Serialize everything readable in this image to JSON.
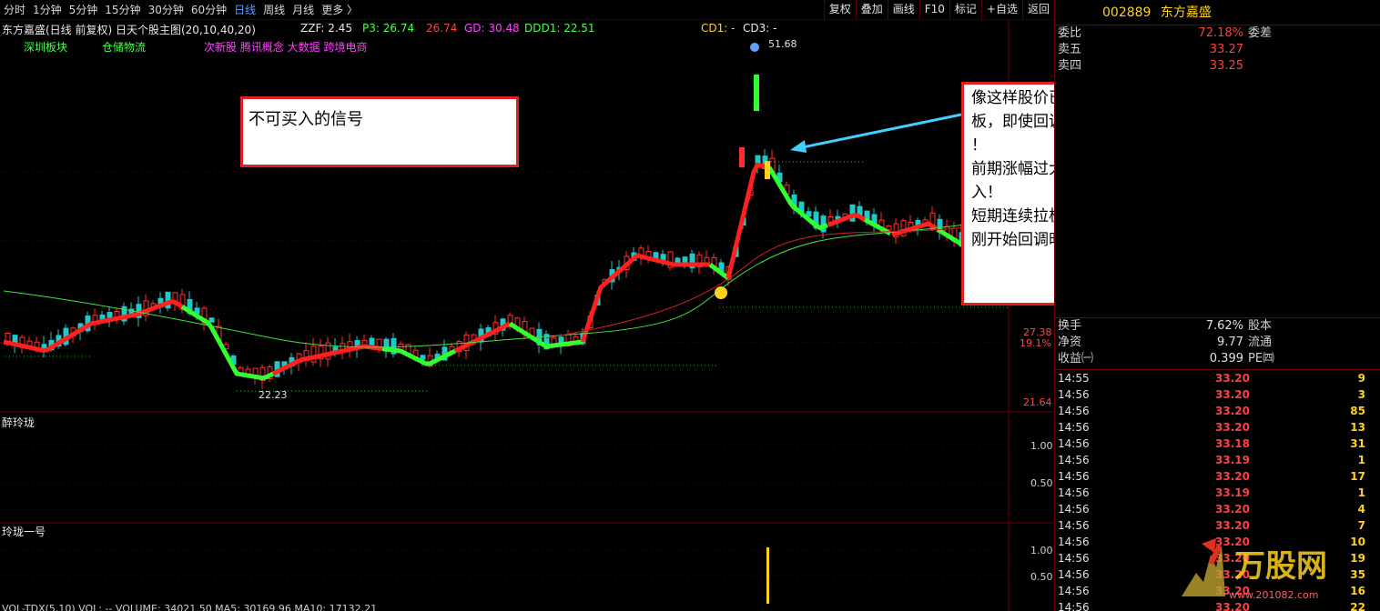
{
  "toolbar": {
    "periods": [
      "分时",
      "1分钟",
      "5分钟",
      "15分钟",
      "30分钟",
      "60分钟",
      "日线",
      "周线",
      "月线",
      "更多 〉"
    ],
    "active_index": 6,
    "buttons": [
      "复权",
      "叠加",
      "画线",
      "F10",
      "标记",
      "+自选",
      "返回"
    ]
  },
  "main_pane": {
    "title": "东方嘉盛(日线 前复权) 日天个股主图(20,10,40,20)",
    "indicators": [
      {
        "text": "ZZF: 2.45",
        "color": "#e8e8e8"
      },
      {
        "text": "P3: 26.74",
        "color": "#4aff4a"
      },
      {
        "text": "26.74",
        "color": "#ff4040"
      },
      {
        "text": "GD: 30.48",
        "color": "#ff40ff"
      },
      {
        "text": "DDD1: 22.51",
        "color": "#4aff4a"
      },
      {
        "text": "CD1: -",
        "color": "#ffd21e"
      },
      {
        "text": "CD3: -",
        "color": "#e8e8e8"
      }
    ],
    "sector_tags": [
      {
        "text": "深圳板块",
        "color": "#4aff4a"
      },
      {
        "text": "仓储物流",
        "color": "#4aff4a"
      },
      {
        "text": "次新股 腾讯概念 大数据 跨境电商",
        "color": "#ff40ff"
      }
    ],
    "high_label": "51.68",
    "low_label": "22.23",
    "axis": [
      {
        "text": "27.38",
        "color": "#ff4a4a"
      },
      {
        "text": "19.1%",
        "color": "#ff4a4a"
      },
      {
        "text": "21.64",
        "color": "#ff4a4a"
      }
    ]
  },
  "pane2": {
    "title": "醉玲珑",
    "axis": [
      "1.00",
      "0.50"
    ]
  },
  "pane3": {
    "title": "玲珑一号",
    "axis": [
      "1.00",
      "0.50"
    ]
  },
  "footer_text": "VOL-TDX(5,10)  VOL: -- VOLUME: 34021.50  MA5: 30169.96  MA10: 17132.21",
  "notes": {
    "note1": "不可买入的信号",
    "note2": [
      "像这样股价已经翻倍，且短期连拉几个",
      "板，即使回调后出予警信号也不要买入",
      "！",
      "前期涨幅过大的票，短期回调时不要买",
      "入！",
      "短期连续拉板的票，已到了阶段高点，",
      "刚开始回调时不要买入！"
    ]
  },
  "sidepanel": {
    "code": "002889",
    "name": "东方嘉盛",
    "wei": {
      "label": "委比",
      "value": "72.18%",
      "label2": "委差"
    },
    "asks": [
      {
        "label": "卖五",
        "value": "33.27"
      },
      {
        "label": "卖四",
        "value": "33.25"
      }
    ],
    "stats": [
      {
        "label": "换手",
        "value": "7.62%",
        "label2": "股本"
      },
      {
        "label": "净资",
        "value": "9.77",
        "label2": "流通"
      },
      {
        "label": "收益㈠",
        "value": "0.399",
        "label2": "PE㈣"
      }
    ],
    "ticks": [
      {
        "t": "14:55",
        "p": "33.20",
        "v": "9"
      },
      {
        "t": "14:56",
        "p": "33.20",
        "v": "3"
      },
      {
        "t": "14:56",
        "p": "33.20",
        "v": "85"
      },
      {
        "t": "14:56",
        "p": "33.20",
        "v": "13"
      },
      {
        "t": "14:56",
        "p": "33.18",
        "v": "31"
      },
      {
        "t": "14:56",
        "p": "33.19",
        "v": "1"
      },
      {
        "t": "14:56",
        "p": "33.20",
        "v": "17"
      },
      {
        "t": "14:56",
        "p": "33.19",
        "v": "1"
      },
      {
        "t": "14:56",
        "p": "33.20",
        "v": "4"
      },
      {
        "t": "14:56",
        "p": "33.20",
        "v": "7"
      },
      {
        "t": "14:56",
        "p": "33.20",
        "v": "10"
      },
      {
        "t": "14:56",
        "p": "33.20",
        "v": "19"
      },
      {
        "t": "14:56",
        "p": "33.20",
        "v": "35"
      },
      {
        "t": "14:56",
        "p": "33.20",
        "v": "16"
      },
      {
        "t": "14:56",
        "p": "33.20",
        "v": "22"
      }
    ]
  },
  "watermark": {
    "brand": "万股网",
    "url": "www.201082.com"
  }
}
